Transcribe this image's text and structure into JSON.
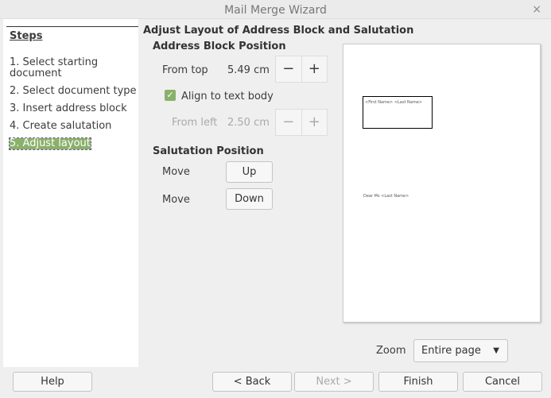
{
  "window": {
    "title": "Mail Merge Wizard",
    "close": "×"
  },
  "steps": {
    "heading": "Steps",
    "items": [
      "1. Select starting document",
      "2. Select document type",
      "3. Insert address block",
      "4. Create salutation",
      "5. Adjust layout"
    ]
  },
  "main": {
    "title": "Adjust Layout of Address Block and Salutation",
    "address": {
      "heading": "Address Block Position",
      "from_top_label": "From top",
      "from_top_value": "5.49 cm",
      "align_label": "Align to text body",
      "align_checked": true,
      "from_left_label": "From left",
      "from_left_value": "2.50 cm",
      "minus": "−",
      "plus": "+"
    },
    "salutation": {
      "heading": "Salutation Position",
      "move1": "Move",
      "up": "Up",
      "move2": "Move",
      "down": "Down"
    }
  },
  "preview": {
    "address_text": "<First Name> <Last Name>",
    "salutation_text": "Dear Ms <Last Name>"
  },
  "zoom": {
    "label": "Zoom",
    "value": "Entire page"
  },
  "footer": {
    "help": "Help",
    "back": "< Back",
    "next": "Next >",
    "finish": "Finish",
    "cancel": "Cancel"
  },
  "colors": {
    "accent": "#8bb06a"
  }
}
